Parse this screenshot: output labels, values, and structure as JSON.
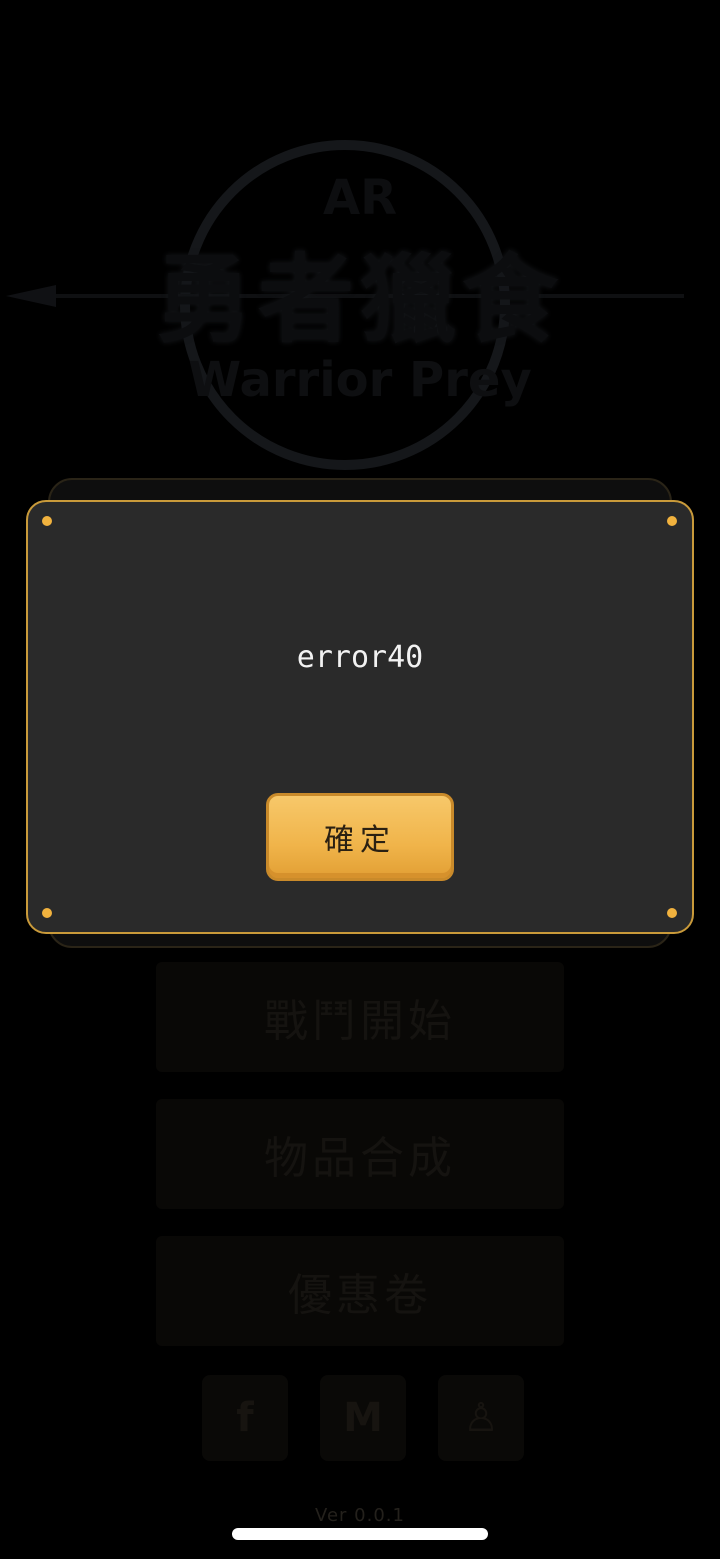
{
  "logo": {
    "ar": "AR",
    "title_kanji": "勇者獵食",
    "subtitle": "Warrior Prey"
  },
  "menu": {
    "battle_start": "戰鬥開始",
    "item_craft": "物品合成",
    "coupon": "優惠卷"
  },
  "social": {
    "facebook_glyph": "f",
    "mail_glyph": "M",
    "profile_glyph": "♙"
  },
  "version": "Ver 0.0.1",
  "dialog": {
    "message": "error40",
    "confirm_label": "確定"
  },
  "colors": {
    "accent": "#f0b44a",
    "border": "#c99a3a",
    "dialog_bg": "#2a2a2a"
  }
}
